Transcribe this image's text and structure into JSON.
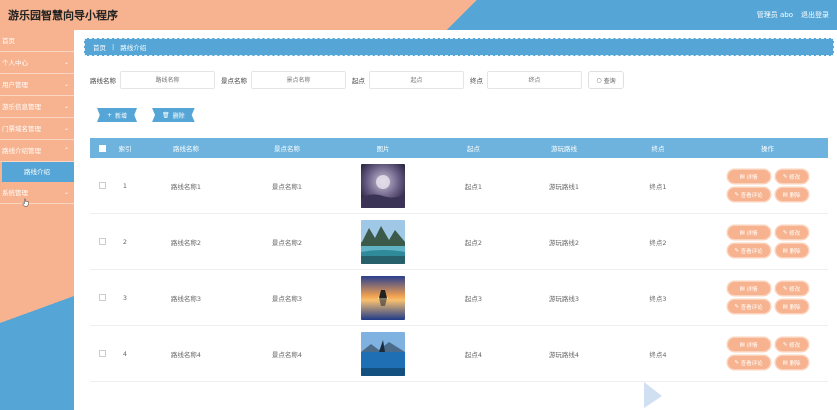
{
  "header": {
    "title": "游乐园智慧向导小程序",
    "admin_label": "管理员 abo",
    "logout_label": "退出登录"
  },
  "sidebar": {
    "items": [
      {
        "label": "首页",
        "has_chevron": false
      },
      {
        "label": "个人中心",
        "has_chevron": true
      },
      {
        "label": "用户管理",
        "has_chevron": true
      },
      {
        "label": "游乐信息管理",
        "has_chevron": true
      },
      {
        "label": "门票域名管理",
        "has_chevron": true
      },
      {
        "label": "路线介绍管理",
        "has_chevron": true
      },
      {
        "label": "路线介绍",
        "sub": true
      },
      {
        "label": "系统管理",
        "has_chevron": true
      }
    ]
  },
  "breadcrumb": {
    "home": "首页",
    "current": "路线介绍"
  },
  "search": {
    "route_name_label": "路线名称",
    "route_name_placeholder": "路线名称",
    "show_name_label": "景点名称",
    "show_name_placeholder": "景点名称",
    "start_label": "起点",
    "start_placeholder": "起点",
    "end_label": "终点",
    "end_placeholder": "终点",
    "query_label": "查询"
  },
  "actions": {
    "add_label": "新增",
    "delete_label": "删除"
  },
  "table": {
    "headers": {
      "index": "索引",
      "route_name": "路线名称",
      "show_name": "景点名称",
      "image": "图片",
      "start": "起点",
      "route": "游玩路线",
      "end": "终点",
      "ops": "操作"
    },
    "op_labels": {
      "detail": "详情",
      "edit": "修改",
      "comment": "查看评论",
      "delete": "删除"
    },
    "rows": [
      {
        "index": "1",
        "route_name": "路线名称1",
        "show_name": "景点名称1",
        "start": "起点1",
        "route": "游玩路线1",
        "end": "终点1",
        "image": "misty-landscape"
      },
      {
        "index": "2",
        "route_name": "路线名称2",
        "show_name": "景点名称2",
        "start": "起点2",
        "route": "游玩路线2",
        "end": "终点2",
        "image": "mountain-lake"
      },
      {
        "index": "3",
        "route_name": "路线名称3",
        "show_name": "景点名称3",
        "start": "起点3",
        "route": "游玩路线3",
        "end": "终点3",
        "image": "sunset-reflection"
      },
      {
        "index": "4",
        "route_name": "路线名称4",
        "show_name": "景点名称4",
        "start": "起点4",
        "route": "游玩路线4",
        "end": "终点4",
        "image": "blue-lake"
      }
    ]
  },
  "colors": {
    "accent_orange": "#f7b38f",
    "accent_blue": "#55a6d6",
    "table_header": "#6db3dd"
  }
}
